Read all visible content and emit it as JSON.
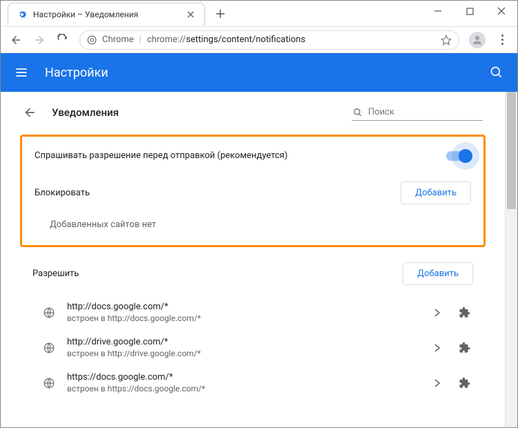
{
  "window": {
    "tab_title": "Настройки – Уведомления"
  },
  "omnibox": {
    "secure_label": "Chrome",
    "url_prefix": "chrome://",
    "url_path": "settings/content/notifications"
  },
  "header": {
    "title": "Настройки"
  },
  "page": {
    "title": "Уведомления",
    "search_placeholder": "Поиск"
  },
  "ask_before": {
    "label": "Спрашивать разрешение перед отправкой (рекомендуется)"
  },
  "block": {
    "title": "Блокировать",
    "add_label": "Добавить",
    "empty": "Добавленных сайтов нет"
  },
  "allow": {
    "title": "Разрешить",
    "add_label": "Добавить",
    "sites": [
      {
        "url": "http://docs.google.com/*",
        "sub": "встроен в http://docs.google.com/*"
      },
      {
        "url": "http://drive.google.com/*",
        "sub": "встроен в http://drive.google.com/*"
      },
      {
        "url": "https://docs.google.com/*",
        "sub": "встроен в https://docs.google.com/*"
      }
    ]
  }
}
